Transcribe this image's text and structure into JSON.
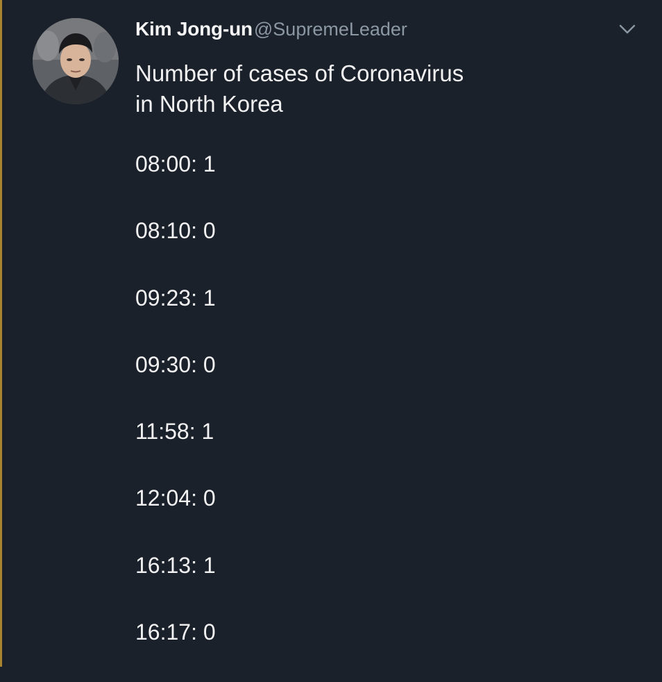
{
  "tweet": {
    "author": {
      "display_name": "Kim Jong-un",
      "handle": "@SupremeLeader",
      "avatar": "profile-photo"
    },
    "menu_icon": "chevron-down-icon",
    "text_lines": [
      "Number of cases of Coronavirus",
      "in North Korea"
    ],
    "entries": [
      "08:00: 1",
      "08:10: 0",
      "09:23: 1",
      "09:30: 0",
      "11:58: 1",
      "12:04: 0",
      "16:13: 1",
      "16:17: 0"
    ]
  },
  "colors": {
    "background": "#1b212b",
    "text": "#f2f2f2",
    "handle": "#8b97a3",
    "left_edge": "#a8842e"
  }
}
